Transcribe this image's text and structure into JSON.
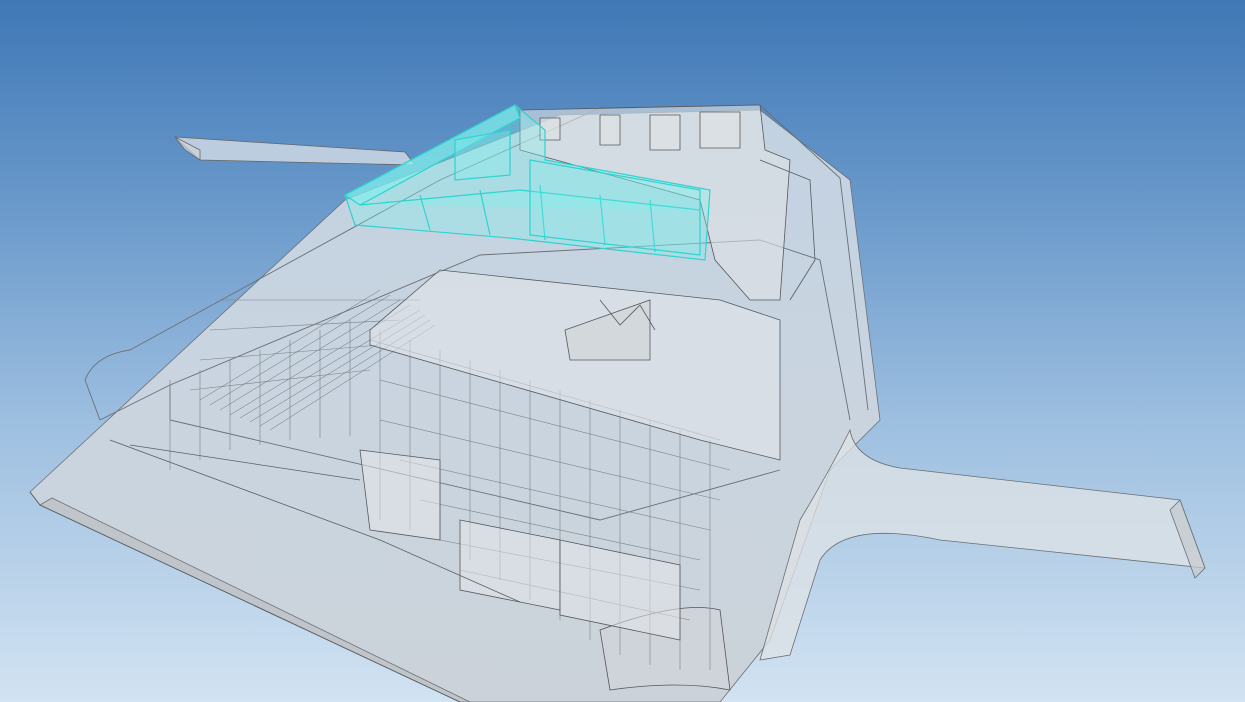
{
  "viewer": {
    "background_top_color": "#3f78b6",
    "background_bottom_color": "#d2e3f2",
    "model_fill_color": "#d9dde0",
    "model_edge_color": "#5f6368",
    "selection_color": "#3fe3e0",
    "selected_element": "highlighted-upper-floor-block"
  }
}
